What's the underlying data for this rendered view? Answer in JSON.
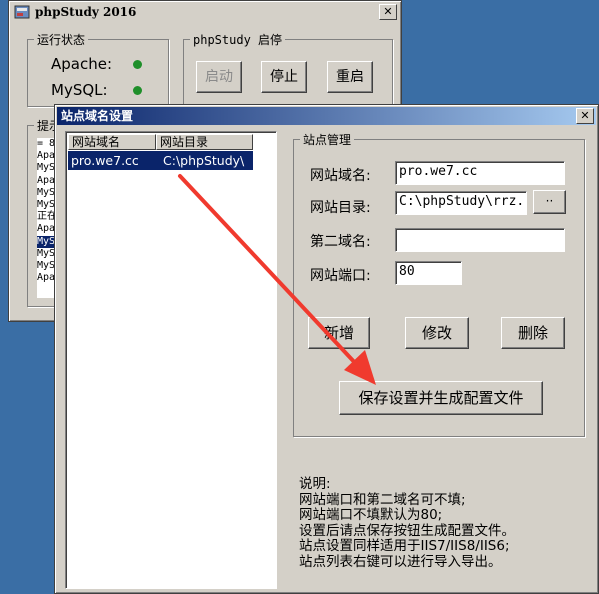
{
  "bg_window": {
    "title": "phpStudy 2016",
    "close": "✕",
    "status_group": "运行状态",
    "services": [
      {
        "name": "Apache:",
        "status_color": "#1f8f2a"
      },
      {
        "name": "MySQL:",
        "status_color": "#1f8f2a"
      }
    ],
    "control_group": "phpStudy 启停",
    "buttons": {
      "start": "启动",
      "stop": "停止",
      "restart": "重启"
    },
    "hint_group": "提示",
    "log_lines": [
      "= 8",
      "Apa",
      "MyS",
      "Apa",
      "MyS",
      "MyS",
      "正在",
      "Apa",
      "MyS",
      "MyS",
      "MyS",
      "Apa"
    ],
    "log_selected_index": 8
  },
  "dialog": {
    "title": "站点域名设置",
    "close": "✕",
    "list": {
      "headers": [
        "网站域名",
        "网站目录"
      ],
      "rows": [
        {
          "domain": "pro.we7.cc",
          "dir": "C:\\phpStudy\\"
        }
      ]
    },
    "site_group": "站点管理",
    "fields": {
      "domain_label": "网站域名:",
      "domain_value": "pro.we7.cc",
      "dir_label": "网站目录:",
      "dir_value": "C:\\phpStudy\\rrz.",
      "browse": "··",
      "second_label": "第二域名:",
      "second_value": "",
      "port_label": "网站端口:",
      "port_value": "80"
    },
    "buttons": {
      "add": "新增",
      "modify": "修改",
      "delete": "删除",
      "save": "保存设置并生成配置文件"
    },
    "notes": [
      "说明:",
      "网站端口和第二域名可不填;",
      "网站端口不填默认为80;",
      "设置后请点保存按钮生成配置文件。",
      "站点设置同样适用于IIS7/IIS8/IIS6;",
      "站点列表右键可以进行导入导出。"
    ]
  },
  "annotation": {
    "arrow_color": "#f03a2e"
  }
}
